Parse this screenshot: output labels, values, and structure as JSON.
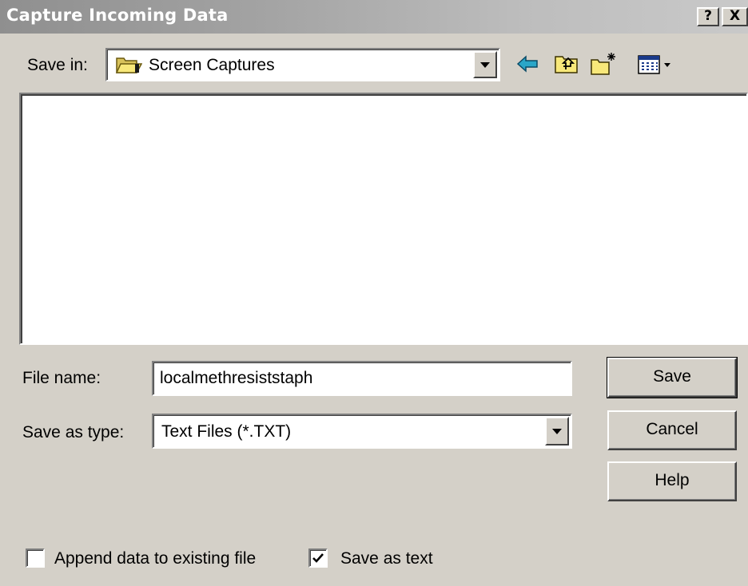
{
  "window": {
    "title": "Capture Incoming Data",
    "help_glyph": "?",
    "close_glyph": "X"
  },
  "save_in": {
    "label": "Save in:",
    "value": "Screen Captures",
    "folder_icon": "open-folder-icon"
  },
  "toolbar": {
    "icons": [
      "back-arrow-icon",
      "up-one-level-icon",
      "new-folder-icon",
      "view-menu-icon"
    ]
  },
  "file_list": {
    "items": []
  },
  "file_name": {
    "label": "File name:",
    "value": "localmethresiststaph"
  },
  "save_as_type": {
    "label": "Save as type:",
    "value": "Text Files (*.TXT)"
  },
  "buttons": {
    "save": "Save",
    "cancel": "Cancel",
    "help": "Help"
  },
  "options": {
    "append": {
      "label": "Append data to existing file",
      "checked": false
    },
    "save_as_text": {
      "label": "Save as text",
      "checked": true
    }
  },
  "colors": {
    "dialog_face": "#d4d0c8",
    "title_text": "#ffffff",
    "back_arrow": "#2aa6c8",
    "folder_yellow": "#f8e87a"
  }
}
